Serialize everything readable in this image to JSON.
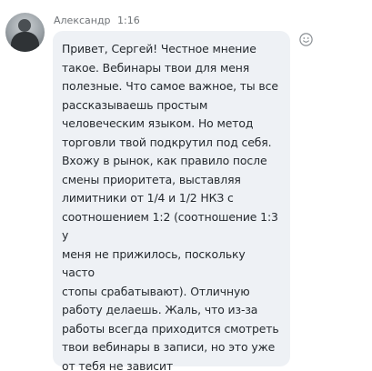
{
  "message": {
    "author": "Александр",
    "time": "1:16",
    "text": "Привет, Сергей! Честное мнение\nтакое. Вебинары твои для меня\nполезные. Что самое важное, ты все\nрассказываешь простым\nчеловеческим языком. Но метод\nторговли твой подкрутил под себя.\nВхожу в рынок, как правило после\nсмены приоритета, выставляя\nлимитники от 1/4 и 1/2 НКЗ с\nсоотношением 1:2 (соотношение 1:3 у\nменя не прижилось, поскольку часто\nстопы срабатывают). Отличную\nработу делаешь. Жаль, что из-за\nработы всегда приходится смотреть\nтвои вебинары в записи, но это уже\nот тебя не зависит"
  },
  "icons": {
    "reaction": "smiley-face-icon"
  },
  "colors": {
    "bubble": "#eef1f5",
    "text": "#24292e",
    "meta": "#6f7377"
  }
}
